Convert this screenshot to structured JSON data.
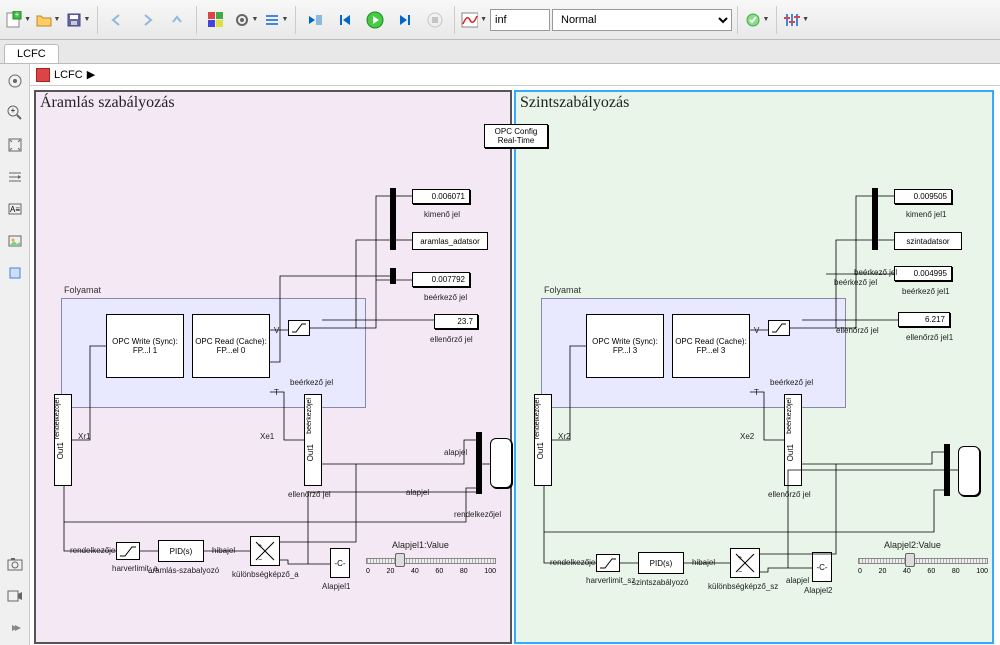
{
  "toolbar": {
    "time_input": "inf",
    "mode_select": "Normal"
  },
  "tab": {
    "name": "LCFC"
  },
  "breadcrumb": {
    "root": "LCFC"
  },
  "opc_config": "OPC Config Real-Time",
  "flow": {
    "title": "Áramlás szabályozás",
    "disp_out": "0.006071",
    "lbl_out": "kimenő jel",
    "ws_block": "aramlas_adatsor",
    "disp_in": "0.007792",
    "lbl_in": "beérkező jel",
    "disp_chk": "23.7",
    "lbl_chk": "ellenőrző jel",
    "opc_write": "OPC Write (Sync):\nFP...l 1",
    "opc_read": "OPC Read (Cache):\nFP...el 0",
    "v": "V",
    "t": "T",
    "port_out1": "Out1",
    "port_xr": "Xr1",
    "port_xe": "Xe1",
    "sub_in": "beérkezőjel",
    "sub_out": "Out1",
    "sub_chk": "ellenőrző jel",
    "sig_in": "beérkező jel",
    "scope_alap": "alapjel",
    "scope_alap2": "alapjel",
    "scope_rend": "rendelkezőjel",
    "pid": "PID(s)",
    "pid_name": "áramlás-szabalyozó",
    "harver": "harverlimit_a",
    "diff": "különbségképző_a",
    "rend": "rendelkezőjel",
    "hiba": "hibajel",
    "const": "-C-",
    "const_name": "Alapjel1",
    "slider_title": "Alapjel1:Value",
    "ticks": [
      "0",
      "20",
      "40",
      "60",
      "80",
      "100"
    ]
  },
  "level": {
    "title": "Szintszabályozás",
    "disp_out": "0.009505",
    "lbl_out": "kimenő jel1",
    "ws_block": "szintadatsor",
    "disp_in": "0.004995",
    "lbl_in": "beérkező jel1",
    "lbl_in0": "beérkező jel",
    "lbl_in00": "beérkező jel",
    "disp_chk": "6.217",
    "lbl_chk": "ellenőrző jel1",
    "lbl_chk0": "ellenőrző jel",
    "opc_write": "OPC Write (Sync):\nFP...l 3",
    "opc_read": "OPC Read (Cache):\nFP...el 3",
    "v": "V",
    "t": "T",
    "port_out1": "Out1",
    "port_xr": "Xr2",
    "port_xe": "Xe2",
    "sub_in": "beérkezőjel",
    "sub_out": "Out1",
    "sub_chk": "ellenőrző jel",
    "sig_in": "beérkező jel",
    "pid": "PID(s)",
    "pid_name": "szintszabályozó",
    "harver": "harverlimit_sz",
    "diff": "különbségképző_sz",
    "rend": "rendelkezőjel",
    "hiba": "hibajel",
    "alap": "alapjel",
    "const": "-C-",
    "const_name": "Alapjel2",
    "slider_title": "Alapjel2:Value",
    "ticks": [
      "0",
      "20",
      "40",
      "60",
      "80",
      "100"
    ]
  }
}
